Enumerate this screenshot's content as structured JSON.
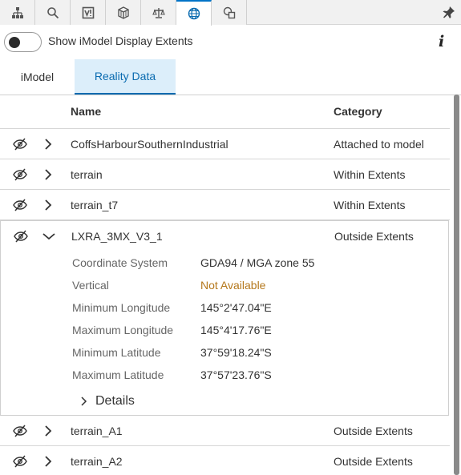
{
  "toolbar": {
    "tabs": [
      {
        "icon": "hierarchy-icon"
      },
      {
        "icon": "search-icon"
      },
      {
        "icon": "properties-icon"
      },
      {
        "icon": "cube-icon"
      },
      {
        "icon": "balance-icon"
      },
      {
        "icon": "globe-icon",
        "active": true
      },
      {
        "icon": "shapes-icon"
      }
    ],
    "pin_icon": "pin-icon"
  },
  "display_extents": {
    "label": "Show iModel Display Extents",
    "enabled": false,
    "info_glyph": "i"
  },
  "view_tabs": [
    {
      "label": "iModel",
      "active": false
    },
    {
      "label": "Reality Data",
      "active": true
    }
  ],
  "table": {
    "columns": {
      "name": "Name",
      "category": "Category"
    },
    "rows": [
      {
        "name": "CoffsHarbourSouthernIndustrial",
        "category": "Attached to model",
        "expanded": false
      },
      {
        "name": "terrain",
        "category": "Within Extents",
        "expanded": false
      },
      {
        "name": "terrain_t7",
        "category": "Within Extents",
        "expanded": false
      },
      {
        "name": "LXRA_3MX_V3_1",
        "category": "Outside Extents",
        "expanded": true
      },
      {
        "name": "terrain_A1",
        "category": "Outside Extents",
        "expanded": false
      },
      {
        "name": "terrain_A2",
        "category": "Outside Extents",
        "expanded": false
      }
    ],
    "expanded_details": {
      "fields": [
        {
          "label": "Coordinate System",
          "value": "GDA94 / MGA zone 55"
        },
        {
          "label": "Vertical",
          "value": "Not Available"
        },
        {
          "label": "Minimum Longitude",
          "value": "145°2'47.04\"E"
        },
        {
          "label": "Maximum Longitude",
          "value": "145°4'17.76\"E"
        },
        {
          "label": "Minimum Latitude",
          "value": "37°59'18.24\"S"
        },
        {
          "label": "Maximum Latitude",
          "value": "37°57'23.76\"S"
        }
      ],
      "details_label": "Details"
    }
  },
  "colors": {
    "accent": "#0a6bb0",
    "active_tab_bg": "#dceefa",
    "warning_text": "#b5781c"
  }
}
